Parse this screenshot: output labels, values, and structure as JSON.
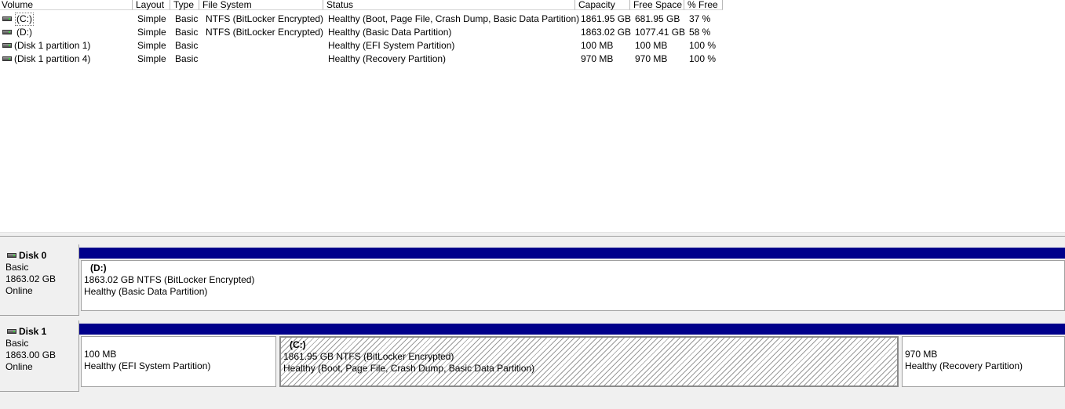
{
  "columns": [
    "Volume",
    "Layout",
    "Type",
    "File System",
    "Status",
    "Capacity",
    "Free Space",
    "% Free"
  ],
  "volumes": [
    {
      "name": "(C:)",
      "layout": "Simple",
      "type": "Basic",
      "fs": "NTFS (BitLocker Encrypted)",
      "status": "Healthy (Boot, Page File, Crash Dump, Basic Data Partition)",
      "capacity": "1861.95 GB",
      "free": "681.95 GB",
      "pct": "37 %"
    },
    {
      "name": "(D:)",
      "layout": "Simple",
      "type": "Basic",
      "fs": "NTFS (BitLocker Encrypted)",
      "status": "Healthy (Basic Data Partition)",
      "capacity": "1863.02 GB",
      "free": "1077.41 GB",
      "pct": "58 %"
    },
    {
      "name": "(Disk 1 partition 1)",
      "layout": "Simple",
      "type": "Basic",
      "fs": "",
      "status": "Healthy (EFI System Partition)",
      "capacity": "100 MB",
      "free": "100 MB",
      "pct": "100 %"
    },
    {
      "name": "(Disk 1 partition 4)",
      "layout": "Simple",
      "type": "Basic",
      "fs": "",
      "status": "Healthy (Recovery Partition)",
      "capacity": "970 MB",
      "free": "970 MB",
      "pct": "100 %"
    }
  ],
  "disks": [
    {
      "title": "Disk 0",
      "type": "Basic",
      "size": "1863.02 GB",
      "state": "Online",
      "partitions": [
        {
          "name": "(D:)",
          "size_fs": "1863.02 GB NTFS (BitLocker Encrypted)",
          "status": "Healthy (Basic Data Partition)"
        }
      ]
    },
    {
      "title": "Disk 1",
      "type": "Basic",
      "size": "1863.00 GB",
      "state": "Online",
      "partitions": [
        {
          "name": "",
          "size_fs": "100 MB",
          "status": "Healthy (EFI System Partition)"
        },
        {
          "name": "(C:)",
          "size_fs": "1861.95 GB NTFS (BitLocker Encrypted)",
          "status": "Healthy (Boot, Page File, Crash Dump, Basic Data Partition)"
        },
        {
          "name": "",
          "size_fs": "970 MB",
          "status": "Healthy (Recovery Partition)"
        }
      ]
    }
  ],
  "icons": {
    "drive": "hard-drive-icon"
  },
  "colors": {
    "partition_bar": "#00008b",
    "background": "#f0f0f0"
  }
}
